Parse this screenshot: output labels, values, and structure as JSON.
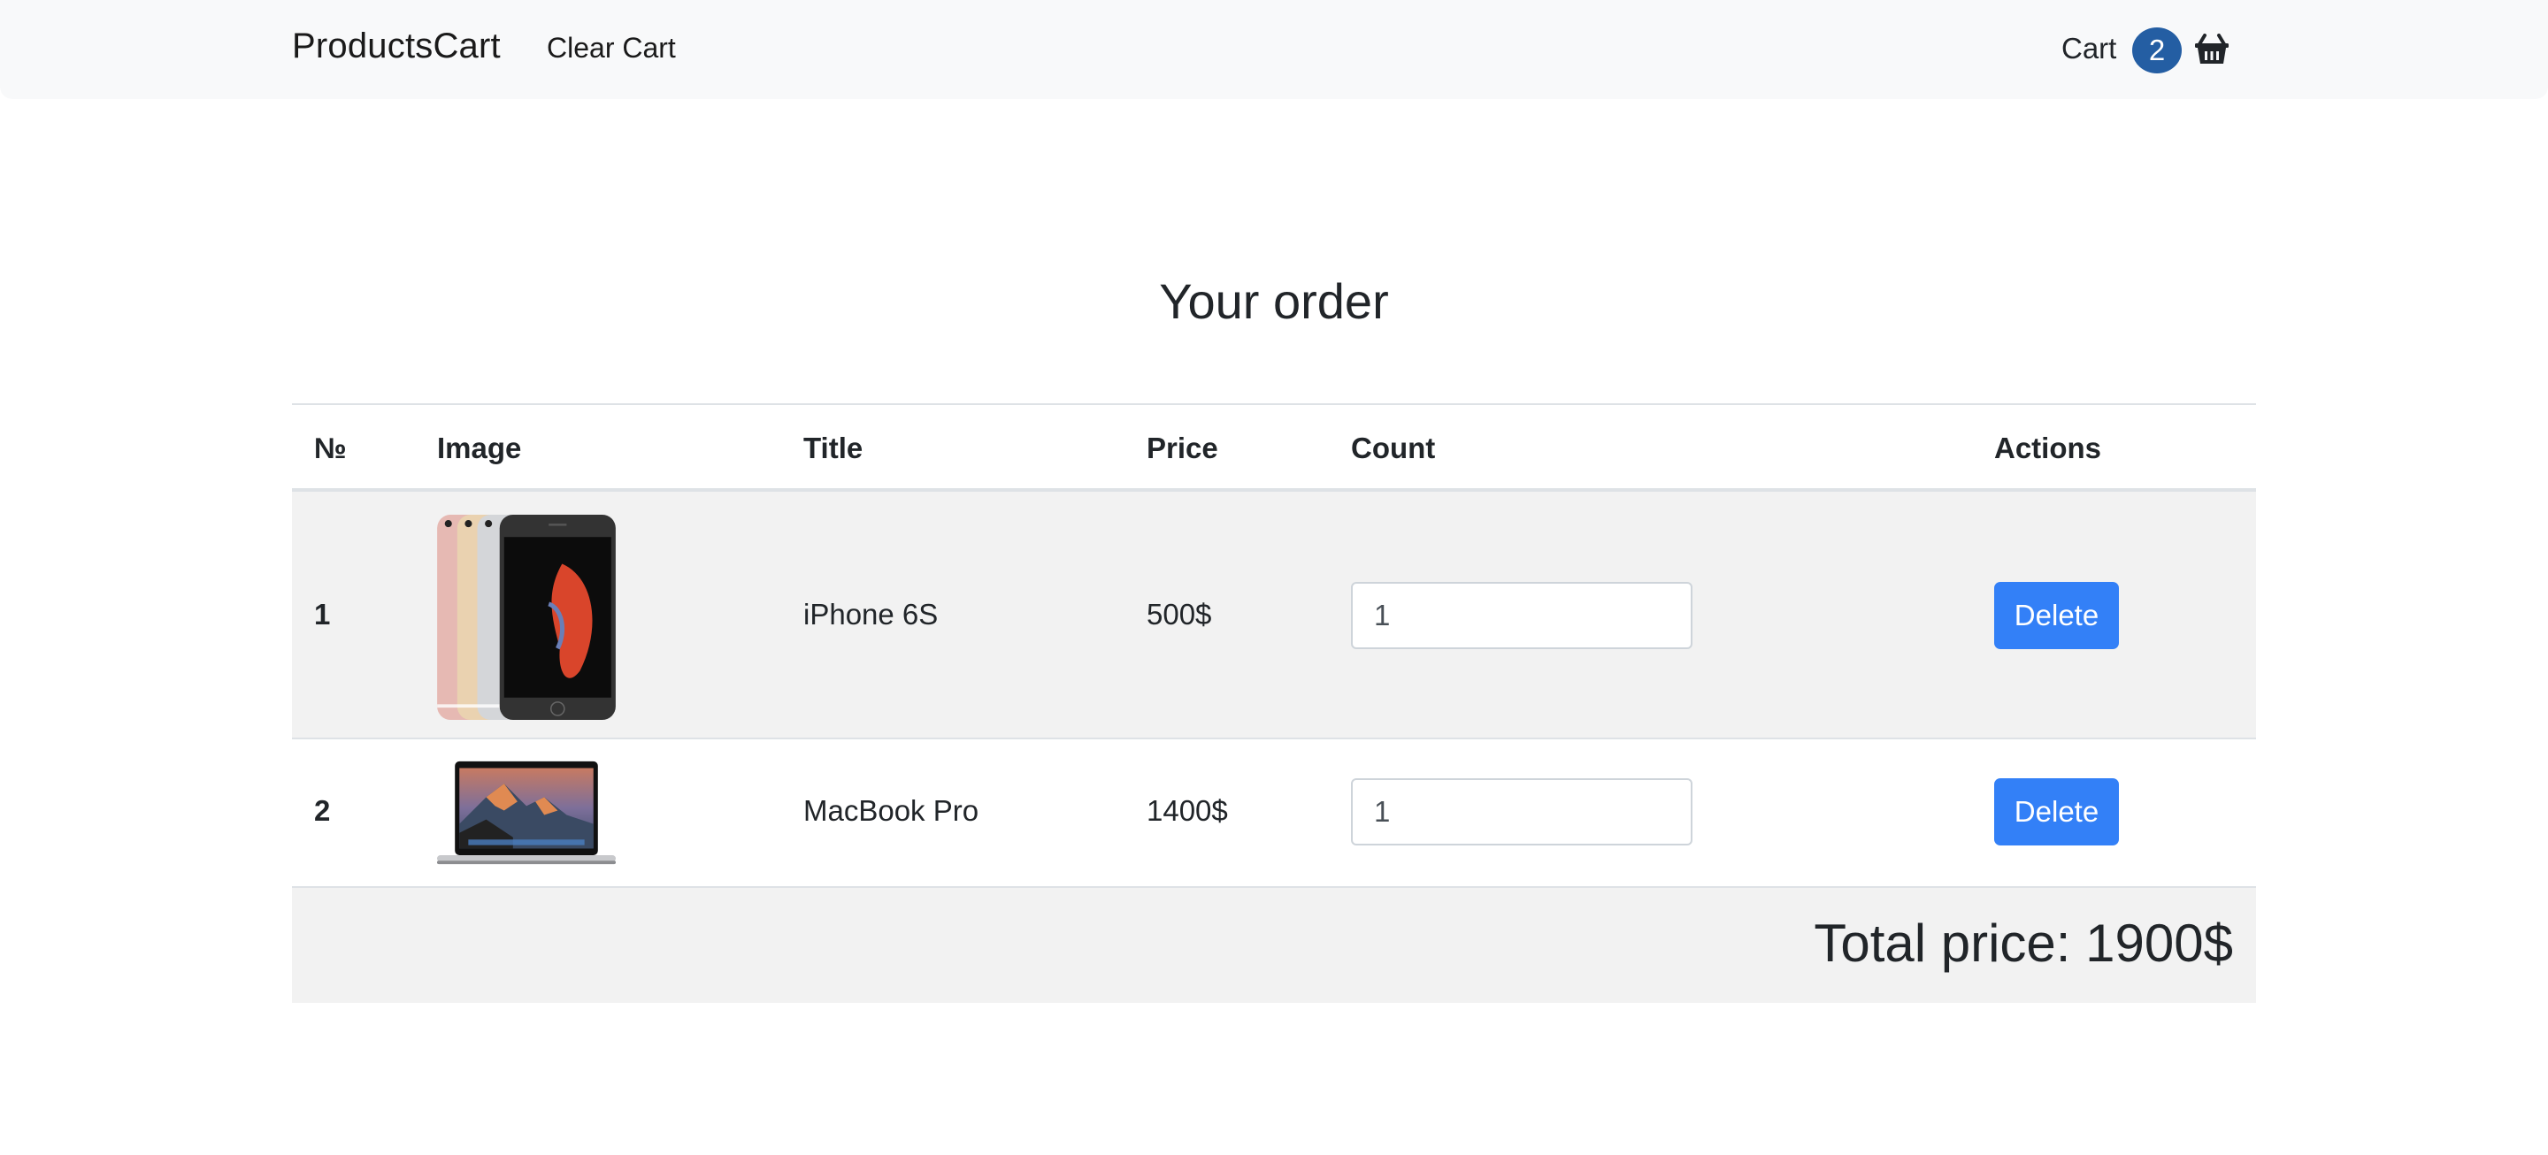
{
  "navbar": {
    "brand": "ProductsCart",
    "clear_cart": "Clear Cart",
    "cart_label": "Cart",
    "cart_count": "2",
    "cart_icon": "basket-icon",
    "badge_color": "#245ea3"
  },
  "page": {
    "title": "Your order"
  },
  "table": {
    "columns": [
      "№",
      "Image",
      "Title",
      "Price",
      "Count",
      "Actions"
    ],
    "rows": [
      {
        "num": "1",
        "image": "iphone-6s-image",
        "title": "iPhone 6S",
        "price": "500$",
        "count": "1",
        "action": "Delete"
      },
      {
        "num": "2",
        "image": "macbook-pro-image",
        "title": "MacBook Pro",
        "price": "1400$",
        "count": "1",
        "action": "Delete"
      }
    ],
    "total_label": "Total price: 1900$"
  },
  "colors": {
    "primary_button": "#3380f7",
    "striped_row": "#f2f2f2",
    "navbar_bg": "#f8f9fa"
  }
}
